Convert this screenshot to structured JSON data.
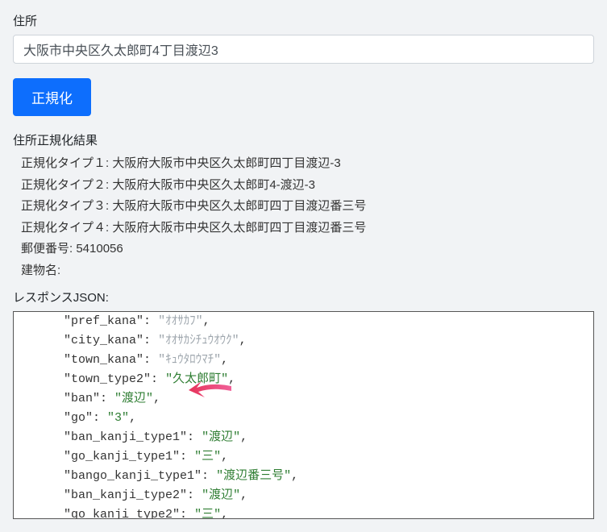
{
  "form": {
    "address_label": "住所",
    "address_value": "大阪市中央区久太郎町4丁目渡辺3",
    "submit_label": "正規化"
  },
  "results": {
    "heading": "住所正規化結果",
    "lines": {
      "type1_label": "正規化タイプ１: ",
      "type1_value": "大阪府大阪市中央区久太郎町四丁目渡辺-3",
      "type2_label": "正規化タイプ２: ",
      "type2_value": "大阪府大阪市中央区久太郎町4-渡辺-3",
      "type3_label": "正規化タイプ３: ",
      "type3_value": "大阪府大阪市中央区久太郎町四丁目渡辺番三号",
      "type4_label": "正規化タイプ４: ",
      "type4_value": "大阪府大阪市中央区久太郎町四丁目渡辺番三号",
      "postal_label": "郵便番号: ",
      "postal_value": "5410056",
      "building_label": "建物名:",
      "building_value": ""
    }
  },
  "json_section": {
    "label": "レスポンスJSON:",
    "lines": [
      {
        "indent": "      ",
        "key": "pref_kana",
        "val": "ｵｵｻｶﾌ",
        "cls": "kana"
      },
      {
        "indent": "      ",
        "key": "city_kana",
        "val": "ｵｵｻｶｼﾁｭｳｵｳｸ",
        "cls": "kana"
      },
      {
        "indent": "      ",
        "key": "town_kana",
        "val": "ｷｭｳﾀﾛｳﾏﾁ",
        "cls": "kana"
      },
      {
        "indent": "      ",
        "key": "town_type2",
        "val": "久太郎町",
        "cls": "str"
      },
      {
        "indent": "      ",
        "key": "ban",
        "val": "渡辺",
        "cls": "str"
      },
      {
        "indent": "      ",
        "key": "go",
        "val": "3",
        "cls": "str"
      },
      {
        "indent": "      ",
        "key": "ban_kanji_type1",
        "val": "渡辺",
        "cls": "str"
      },
      {
        "indent": "      ",
        "key": "go_kanji_type1",
        "val": "三",
        "cls": "str"
      },
      {
        "indent": "      ",
        "key": "bango_kanji_type1",
        "val": "渡辺番三号",
        "cls": "str"
      },
      {
        "indent": "      ",
        "key": "ban_kanji_type2",
        "val": "渡辺",
        "cls": "str"
      },
      {
        "indent": "      ",
        "key": "go_kanji_type2",
        "val": "三",
        "cls": "str"
      }
    ]
  },
  "chart_data": {
    "type": "table",
    "title": "住所正規化結果",
    "rows": [
      {
        "label": "正規化タイプ１",
        "value": "大阪府大阪市中央区久太郎町四丁目渡辺-3"
      },
      {
        "label": "正規化タイプ２",
        "value": "大阪府大阪市中央区久太郎町4-渡辺-3"
      },
      {
        "label": "正規化タイプ３",
        "value": "大阪府大阪市中央区久太郎町四丁目渡辺番三号"
      },
      {
        "label": "正規化タイプ４",
        "value": "大阪府大阪市中央区久太郎町四丁目渡辺番三号"
      },
      {
        "label": "郵便番号",
        "value": "5410056"
      },
      {
        "label": "建物名",
        "value": ""
      }
    ],
    "response_json_fields": {
      "pref_kana": "ｵｵｻｶﾌ",
      "city_kana": "ｵｵｻｶｼﾁｭｳｵｳｸ",
      "town_kana": "ｷｭｳﾀﾛｳﾏﾁ",
      "town_type2": "久太郎町",
      "ban": "渡辺",
      "go": "3",
      "ban_kanji_type1": "渡辺",
      "go_kanji_type1": "三",
      "bango_kanji_type1": "渡辺番三号",
      "ban_kanji_type2": "渡辺",
      "go_kanji_type2": "三"
    }
  }
}
